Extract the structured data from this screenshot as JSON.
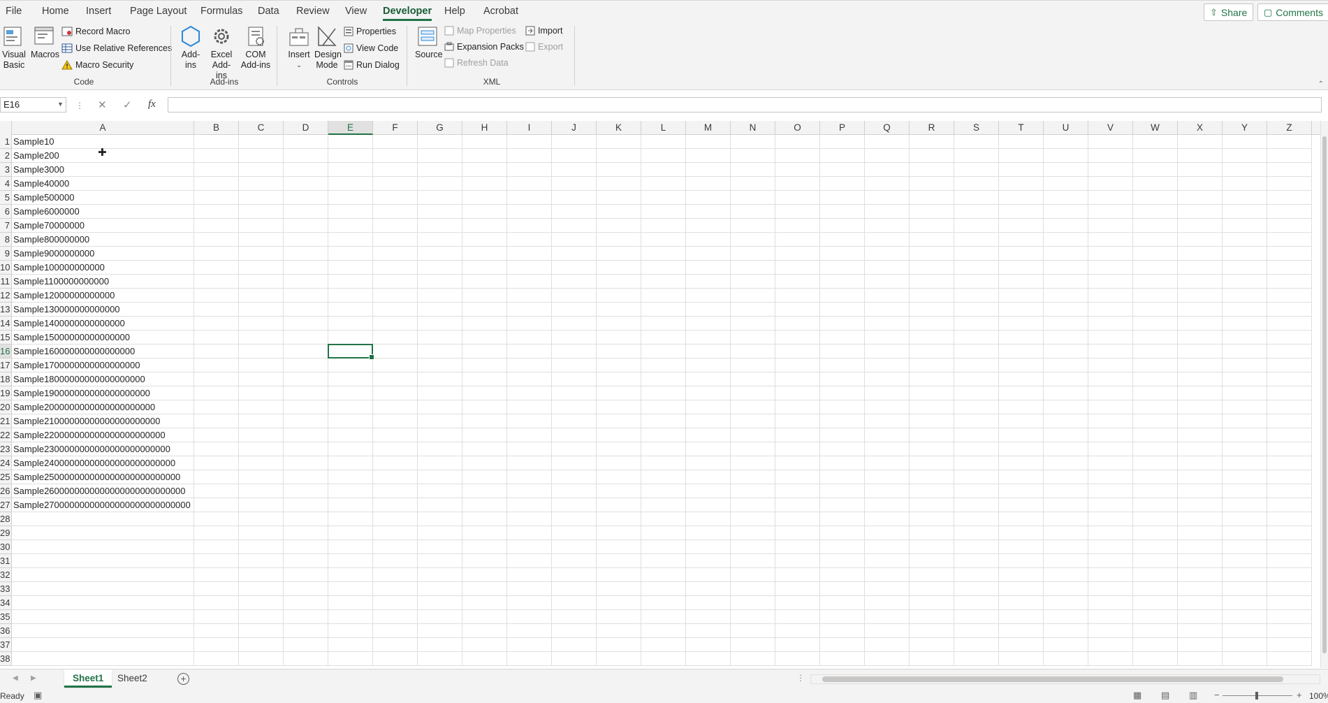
{
  "menu": {
    "tabs": [
      "File",
      "Home",
      "Insert",
      "Page Layout",
      "Formulas",
      "Data",
      "Review",
      "View",
      "Developer",
      "Help",
      "Acrobat"
    ],
    "active_tab": "Developer",
    "share_label": "Share",
    "comments_label": "Comments"
  },
  "ribbon": {
    "code": {
      "label": "Code",
      "visual_basic": "Visual Basic",
      "macros": "Macros",
      "record_macro": "Record Macro",
      "use_relative_references": "Use Relative References",
      "macro_security": "Macro Security"
    },
    "addins": {
      "label": "Add-ins",
      "addins": "Add-ins",
      "excel_addins": "Excel Add-ins",
      "com_addins": "COM Add-ins"
    },
    "controls": {
      "label": "Controls",
      "insert": "Insert",
      "design_mode": "Design Mode",
      "properties": "Properties",
      "view_code": "View Code",
      "run_dialog": "Run Dialog"
    },
    "xml": {
      "label": "XML",
      "source": "Source",
      "map_properties": "Map Properties",
      "expansion_packs": "Expansion Packs",
      "refresh_data": "Refresh Data",
      "import": "Import",
      "export": "Export"
    }
  },
  "formula_bar": {
    "name_box": "E16",
    "fx_label": "fx",
    "formula": ""
  },
  "grid": {
    "columns": [
      "A",
      "B",
      "C",
      "D",
      "E",
      "F",
      "G",
      "H",
      "I",
      "J",
      "K",
      "L",
      "M",
      "N",
      "O",
      "P",
      "Q",
      "R",
      "S",
      "T",
      "U",
      "V",
      "W",
      "X",
      "Y",
      "Z"
    ],
    "selected_column": "E",
    "selected_row": 16,
    "row_count": 38,
    "column_a_values": [
      "Sample10",
      "Sample200",
      "Sample3000",
      "Sample40000",
      "Sample500000",
      "Sample6000000",
      "Sample70000000",
      "Sample800000000",
      "Sample9000000000",
      "Sample100000000000",
      "Sample1100000000000",
      "Sample12000000000000",
      "Sample130000000000000",
      "Sample1400000000000000",
      "Sample15000000000000000",
      "Sample160000000000000000",
      "Sample1700000000000000000",
      "Sample18000000000000000000",
      "Sample190000000000000000000",
      "Sample2000000000000000000000",
      "Sample21000000000000000000000",
      "Sample220000000000000000000000",
      "Sample2300000000000000000000000",
      "Sample24000000000000000000000000",
      "Sample250000000000000000000000000",
      "Sample2600000000000000000000000000",
      "Sample27000000000000000000000000000"
    ]
  },
  "sheets": {
    "tabs": [
      "Sheet1",
      "Sheet2"
    ],
    "active": "Sheet1"
  },
  "status": {
    "text": "Ready",
    "zoom": "100%"
  }
}
